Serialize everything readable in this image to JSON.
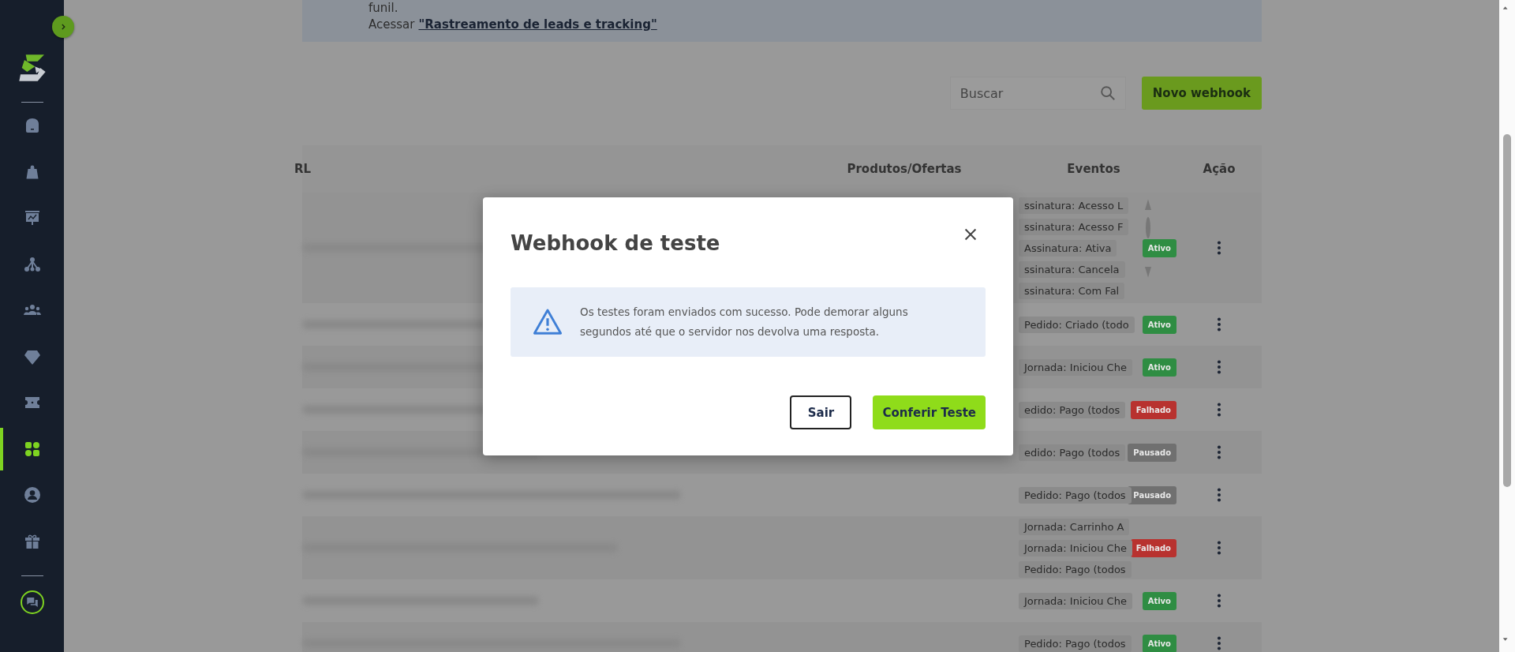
{
  "sidebar": {
    "items": [
      {
        "selected": false
      },
      {
        "selected": false
      },
      {
        "selected": false
      },
      {
        "selected": false
      },
      {
        "selected": false
      },
      {
        "selected": false
      },
      {
        "selected": false
      },
      {
        "selected": true
      },
      {
        "selected": false
      },
      {
        "selected": false
      }
    ]
  },
  "banner": {
    "line_1": "funil.",
    "prefix": "Acessar",
    "link": "\"Rastreamento de leads e tracking\""
  },
  "search": {
    "placeholder": "Buscar"
  },
  "new_button": "Novo webhook",
  "table": {
    "columns": [
      "RL",
      "Produtos/Ofertas",
      "Eventos",
      "Ação"
    ],
    "rows": [
      {
        "events": [
          "ssinatura: Acesso L",
          "ssinatura: Acesso F",
          "Assinatura: Ativa",
          "ssinatura: Cancela",
          "ssinatura: Com Fal"
        ],
        "status": {
          "label": "Ativo",
          "color": "#2f8d43"
        }
      },
      {
        "events": [
          "Pedido: Criado (todo"
        ],
        "status": {
          "label": "Ativo",
          "color": "#2f8d43"
        }
      },
      {
        "events": [
          "Jornada: Iniciou Che"
        ],
        "status": {
          "label": "Ativo",
          "color": "#2f8d43"
        }
      },
      {
        "events": [
          "edido: Pago (todos"
        ],
        "status": {
          "label": "Falhado",
          "color": "#b8322f"
        }
      },
      {
        "events": [
          "edido: Pago (todos"
        ],
        "status": {
          "label": "Pausado",
          "color": "#707070"
        }
      },
      {
        "events": [
          "Pedido: Pago (todos"
        ],
        "status": {
          "label": "Pausado",
          "color": "#707070"
        }
      },
      {
        "events": [
          "Jornada: Carrinho A",
          "Jornada: Iniciou Che",
          "Pedido: Pago (todos"
        ],
        "status": {
          "label": "Falhado",
          "color": "#b8322f"
        }
      },
      {
        "events": [
          "Jornada: Iniciou Che"
        ],
        "status": {
          "label": "Ativo",
          "color": "#2f8d43"
        }
      },
      {
        "events": [
          "Pedido: Pago (todos"
        ],
        "status": {
          "label": "Ativo",
          "color": "#2f8d43"
        }
      }
    ]
  },
  "modal": {
    "title": "Webhook de teste",
    "message": "Os testes foram enviados com sucesso. Pode demorar alguns segundos até que o servidor nos devolva uma resposta.",
    "buttons": [
      "Sair",
      "Conferir Teste"
    ]
  }
}
